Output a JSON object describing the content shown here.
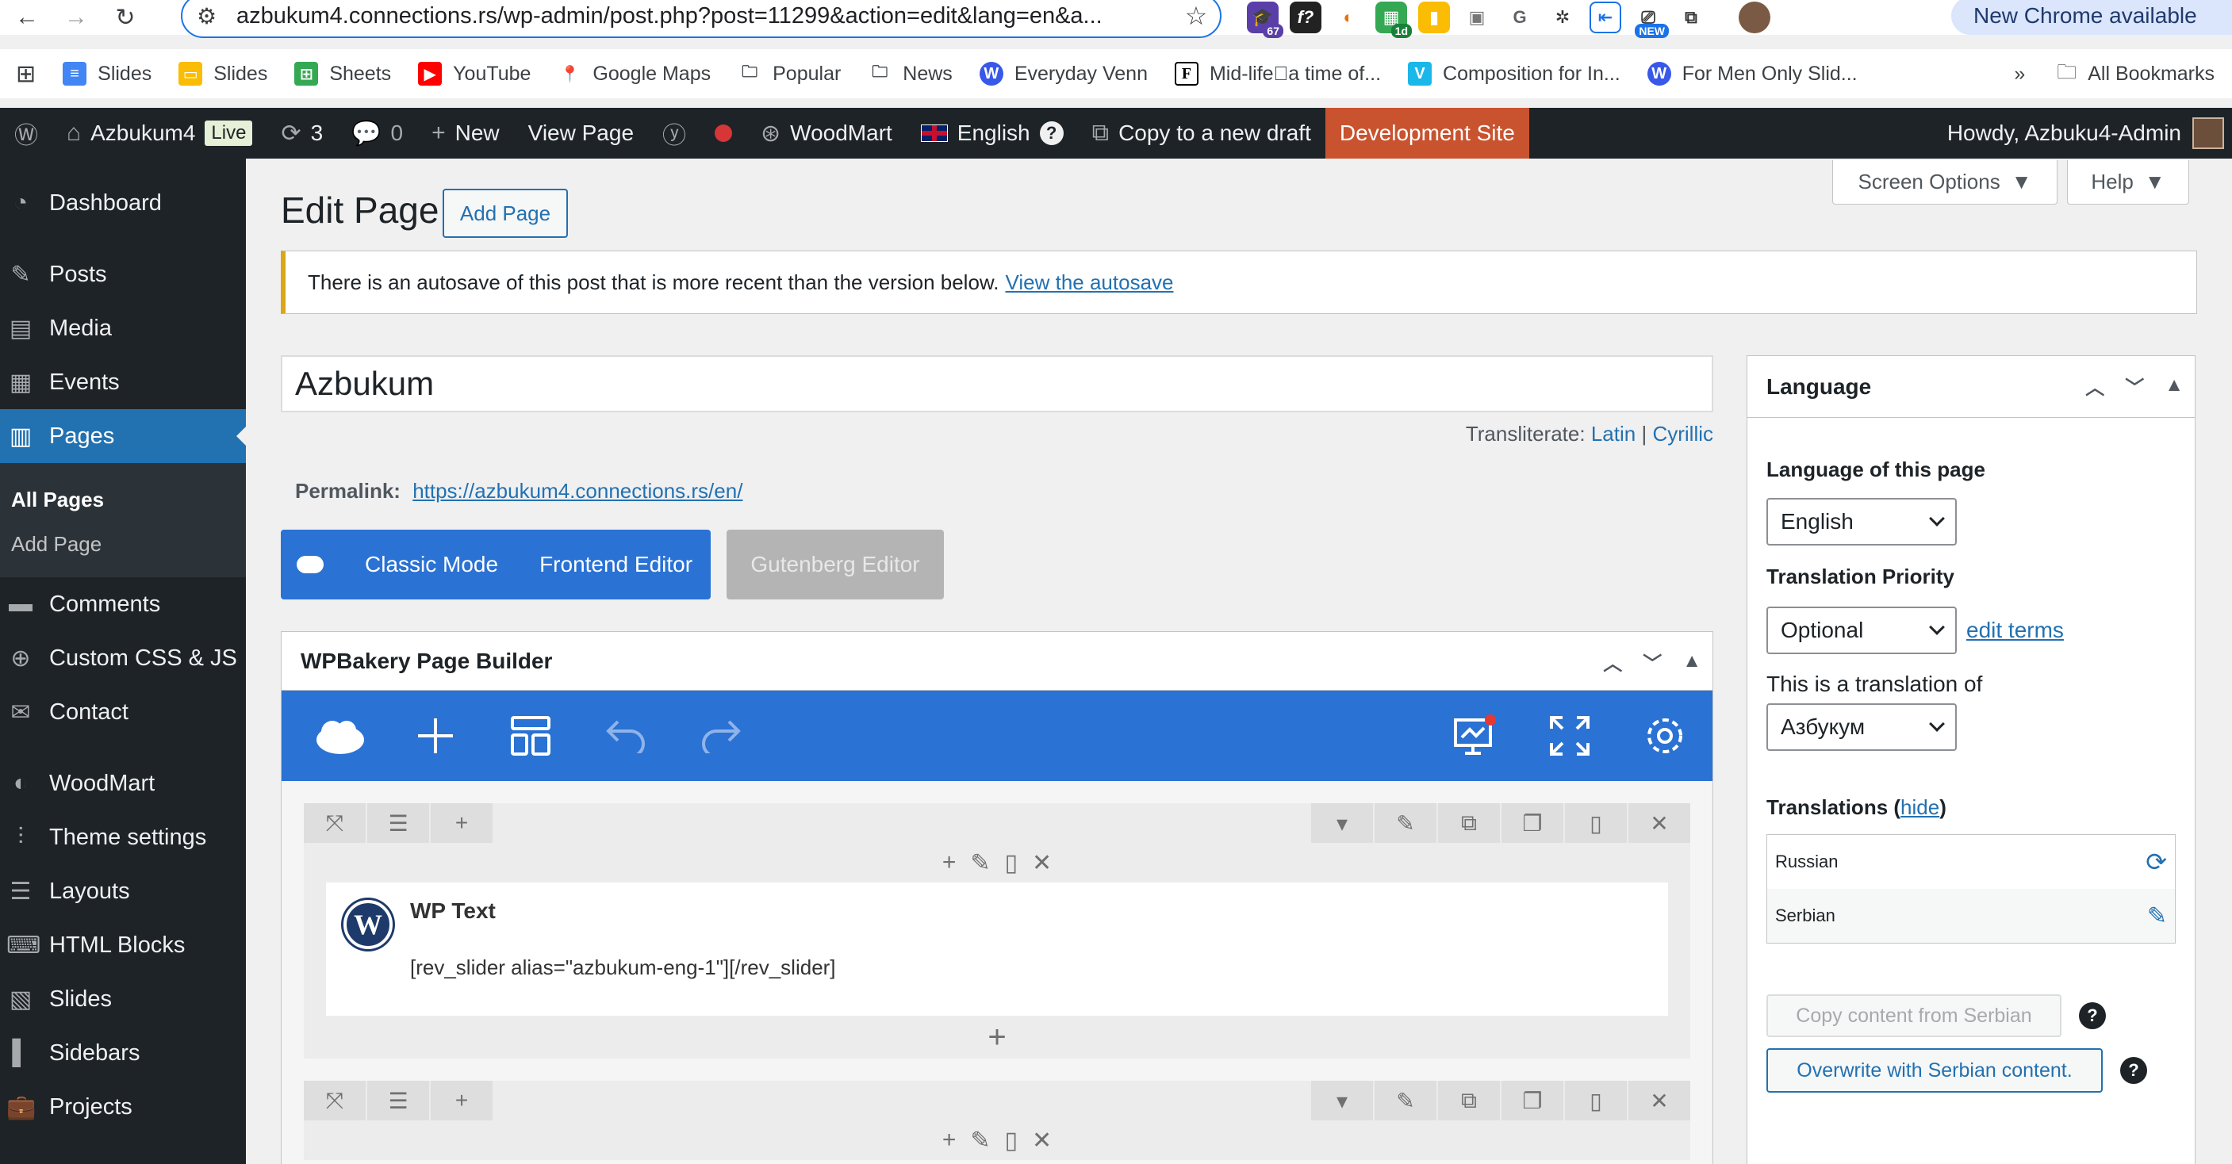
{
  "browser": {
    "url": "azbukum4.connections.rs/wp-admin/post.php?post=11299&action=edit&lang=en&a...",
    "new_chrome": "New Chrome available",
    "ext_badge_67": "67",
    "ext_badge_1d": "1d",
    "ext_badge_new": "NEW"
  },
  "bookmarks": {
    "items": [
      "Slides",
      "Sheets",
      "YouTube",
      "Google Maps",
      "Popular",
      "News",
      "Everyday Venn",
      "Mid-life\u0000a time of...",
      "Composition for In...",
      "For Men Only Slid..."
    ],
    "more": "»",
    "all": "All Bookmarks"
  },
  "adminbar": {
    "site": "Azbukum4",
    "live": "Live",
    "updates": "3",
    "comments": "0",
    "new": "New",
    "view_page": "View Page",
    "woodmart": "WoodMart",
    "language": "English",
    "help": "?",
    "copy_draft": "Copy to a new draft",
    "dev_site": "Development Site",
    "howdy": "Howdy, Azbuku4-Admin"
  },
  "sidebar": {
    "items": [
      "Dashboard",
      "Posts",
      "Media",
      "Events",
      "Pages",
      "Comments",
      "Custom CSS & JS",
      "Contact",
      "WoodMart",
      "Theme settings",
      "Layouts",
      "HTML Blocks",
      "Slides",
      "Sidebars",
      "Projects"
    ],
    "sub_all": "All Pages",
    "sub_add": "Add Page"
  },
  "page": {
    "title": "Edit Page",
    "add_page": "Add Page",
    "screen_options": "Screen Options",
    "help": "Help",
    "notice_text": "There is an autosave of this post that is more recent than the version below.",
    "notice_link": "View the autosave",
    "post_title": "Azbukum",
    "translit_label": "Transliterate:",
    "translit_latin": "Latin",
    "translit_sep": "|",
    "translit_cyrillic": "Cyrillic",
    "permalink_label": "Permalink:",
    "permalink_url": "https://azbukum4.connections.rs/en/",
    "classic_mode": "Classic Mode",
    "frontend_editor": "Frontend Editor",
    "gutenberg": "Gutenberg Editor"
  },
  "wpbakery": {
    "title": "WPBakery Page Builder",
    "element_title": "WP Text",
    "element_content": "[rev_slider alias=\"azbukum-eng-1\"][/rev_slider]"
  },
  "language_box": {
    "title": "Language",
    "lang_label": "Language of this page",
    "lang_value": "English",
    "priority_label": "Translation Priority",
    "priority_value": "Optional",
    "edit_terms": "edit terms",
    "translation_of_label": "This is a translation of",
    "translation_of_value": "Азбукум",
    "translations_label": "Translations (",
    "hide": "hide",
    "translations_close": ")",
    "rows": [
      "Russian",
      "Serbian"
    ],
    "copy_btn": "Copy content from Serbian",
    "overwrite_btn": "Overwrite with Serbian content.",
    "q": "?"
  },
  "colors": {
    "wp_blue": "#2271b1",
    "wpb_blue": "#2a72d4",
    "admin_dark": "#1d2327",
    "dev_orange": "#c9532f",
    "notice_yellow": "#dba617"
  }
}
